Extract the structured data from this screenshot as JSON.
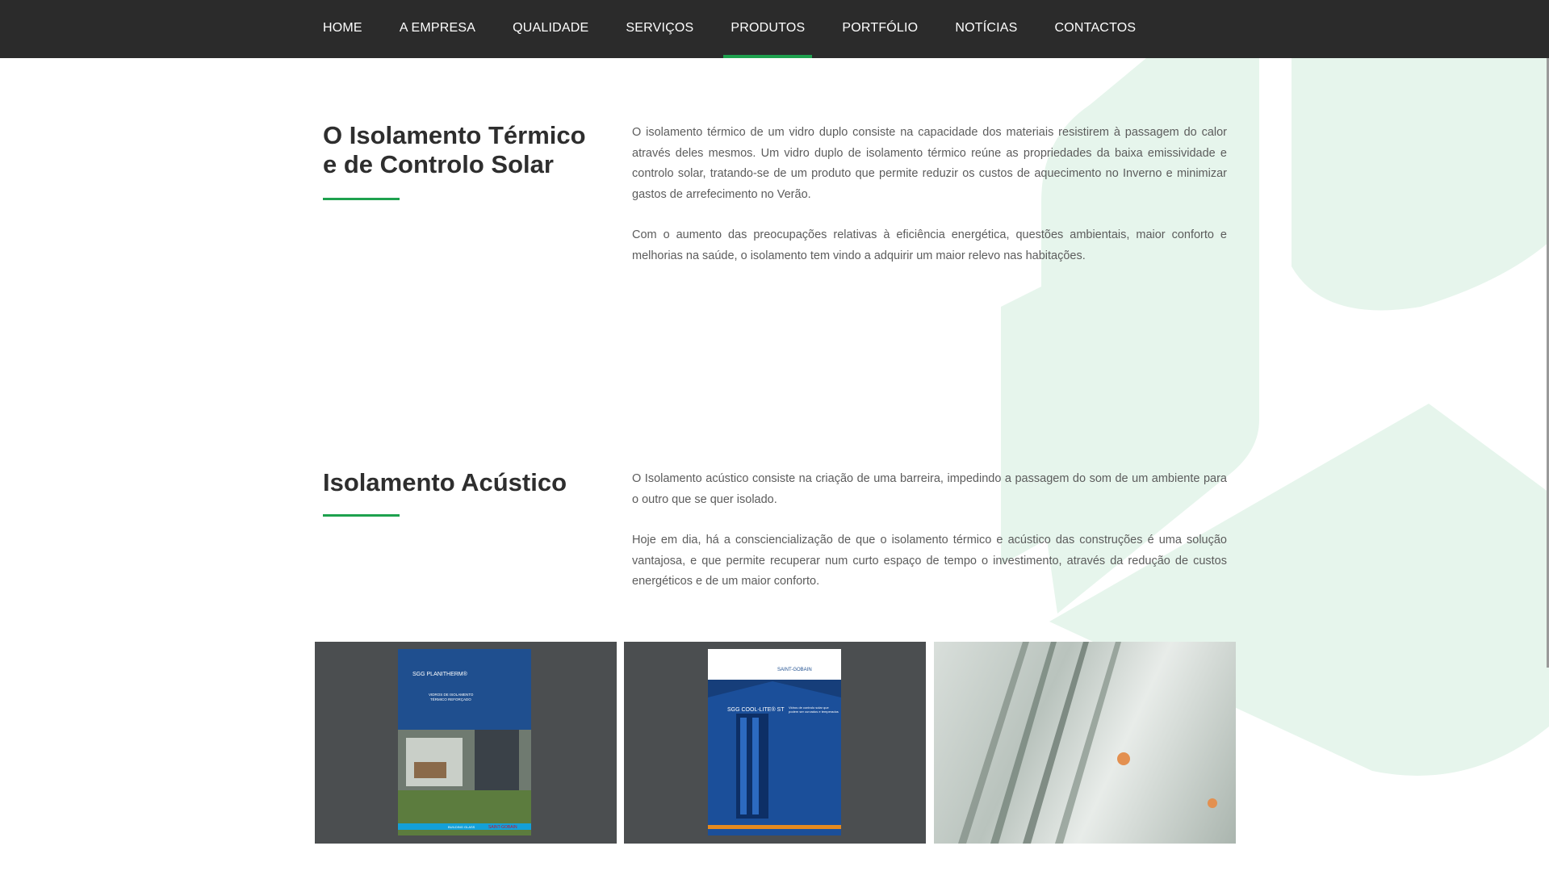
{
  "nav": {
    "items": [
      {
        "label": "HOME"
      },
      {
        "label": "A EMPRESA"
      },
      {
        "label": "QUALIDADE"
      },
      {
        "label": "SERVIÇOS"
      },
      {
        "label": "PRODUTOS",
        "active": true
      },
      {
        "label": "PORTFÓLIO"
      },
      {
        "label": "NOTÍCIAS"
      },
      {
        "label": "CONTACTOS"
      }
    ]
  },
  "thermal": {
    "title_line1": "O Isolamento Térmico",
    "title_line2": "e de Controlo Solar",
    "p1": "O isolamento térmico de um vidro duplo consiste na capacidade dos materiais resistirem à passagem do calor através deles mesmos. Um vidro duplo de isolamento térmico reúne as propriedades da baixa emissividade e controlo solar, tratando-se de um produto que permite reduzir os custos de aquecimento no Inverno e minimizar gastos de arrefecimento no Verão.",
    "p2": "Com o aumento das preocupações relativas à eficiência energética, questões ambientais, maior conforto e melhorias na saúde, o isolamento tem vindo a adquirir um maior relevo nas habitações."
  },
  "acoustic": {
    "title": "Isolamento Acústico",
    "p1": "O Isolamento acústico consiste na criação de uma barreira, impedindo a passagem do som de um ambiente para o outro que se quer isolado.",
    "p2": "Hoje em dia, há a consciencialização de que o isolamento térmico e acústico das construções é uma solução vantajosa, e que permite recuperar num curto espaço de tempo o investimento, através da redução de custos energéticos e de um maior conforto."
  },
  "gallery": {
    "brochure1": {
      "brand": "SGG PLANITHERM®",
      "subtitle1": "VIDROS DE ISOLAMENTO",
      "subtitle2": "TÉRMICO REFORÇADO",
      "footer_label": "BUILDING GLASS",
      "logo": "SAINT-GOBAIN"
    },
    "brochure2": {
      "logo": "SAINT-GOBAIN",
      "brand": "SGG COOL-LITE® ST",
      "subtitle": "Vidros de controlo solar que podem ser curvados e temperados"
    }
  },
  "colors": {
    "accent": "#1ea14e",
    "nav_bg": "#2b2b2b",
    "shape": "#e6f5ec"
  }
}
